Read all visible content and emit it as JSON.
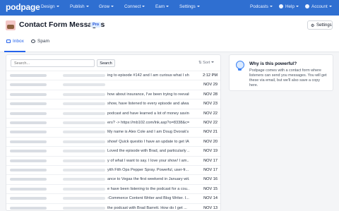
{
  "nav": {
    "brand": "podpage",
    "items": [
      {
        "label": "Design",
        "dropdown": true
      },
      {
        "label": "Publish",
        "dropdown": true
      },
      {
        "label": "Grow",
        "dropdown": true
      },
      {
        "label": "Connect",
        "dropdown": true
      },
      {
        "label": "Earn",
        "dropdown": true
      },
      {
        "label": "Settings",
        "dropdown": true
      }
    ],
    "right": {
      "podcasts": "Podcasts",
      "help": "Help",
      "account": "Account"
    }
  },
  "header": {
    "title": "Contact Form Messages",
    "badge": "Pro",
    "settings_label": "Settings",
    "settings_icon": "gear-icon"
  },
  "tabs": [
    {
      "label": "Inbox",
      "active": true,
      "icon": "inbox-icon"
    },
    {
      "label": "Spam",
      "active": false,
      "icon": "spam-icon"
    }
  ],
  "list": {
    "search_placeholder": "Search...",
    "search_button": "Search",
    "sort_label": "Sort",
    "rows": [
      {
        "excerpt": "ing to episode #142 and I am curious what I sh...",
        "date": "2:12 PM"
      },
      {
        "excerpt": "",
        "date": "NOV 29"
      },
      {
        "excerpt": "how about insurance, I've been trying to reevalu...",
        "date": "NOV 28"
      },
      {
        "excerpt": "show, have listened to every episode and alwa...",
        "date": "NOV 23"
      },
      {
        "excerpt": "podcast and have learned a lot of money saving ti...",
        "date": "NOV 22"
      },
      {
        "excerpt": "ers? -> https://mb102.com/lnk.asp?o=8338&c=51...",
        "date": "NOV 22"
      },
      {
        "excerpt": "My name is Alex Cole and I am Doug Dvorak's ...",
        "date": "NOV 21"
      },
      {
        "excerpt": "show! Quick questio I have an update to get IA...",
        "date": "NOV 20"
      },
      {
        "excerpt": "Loved the episode with Brad, and particularly ...",
        "date": "NOV 19"
      },
      {
        "excerpt": "y of what I want to say. I love your show! I am...",
        "date": "NOV 17"
      },
      {
        "excerpt": "yith Fith Ops Pepper Spray. Powerful, user-fr...",
        "date": "NOV 17"
      },
      {
        "excerpt": "ance to Vegas the first weekend in January wit...",
        "date": "NOV 16"
      },
      {
        "excerpt": "e have been listening to the podcast for a cou...",
        "date": "NOV 15"
      },
      {
        "excerpt": "-Commerce Content Writer and Blog Writer. I...",
        "date": "NOV 14"
      },
      {
        "excerpt": "the podcast with Brad Barrett. How do I get ...",
        "date": "NOV 13"
      }
    ]
  },
  "info": {
    "title": "Why is this powerful?",
    "text": "Podpage comes with a contact form where listeners can send you messages. You will get these via email, but we'll also save a copy here.",
    "icon": "lightbulb-icon",
    "accent": "#2f6fd1"
  }
}
